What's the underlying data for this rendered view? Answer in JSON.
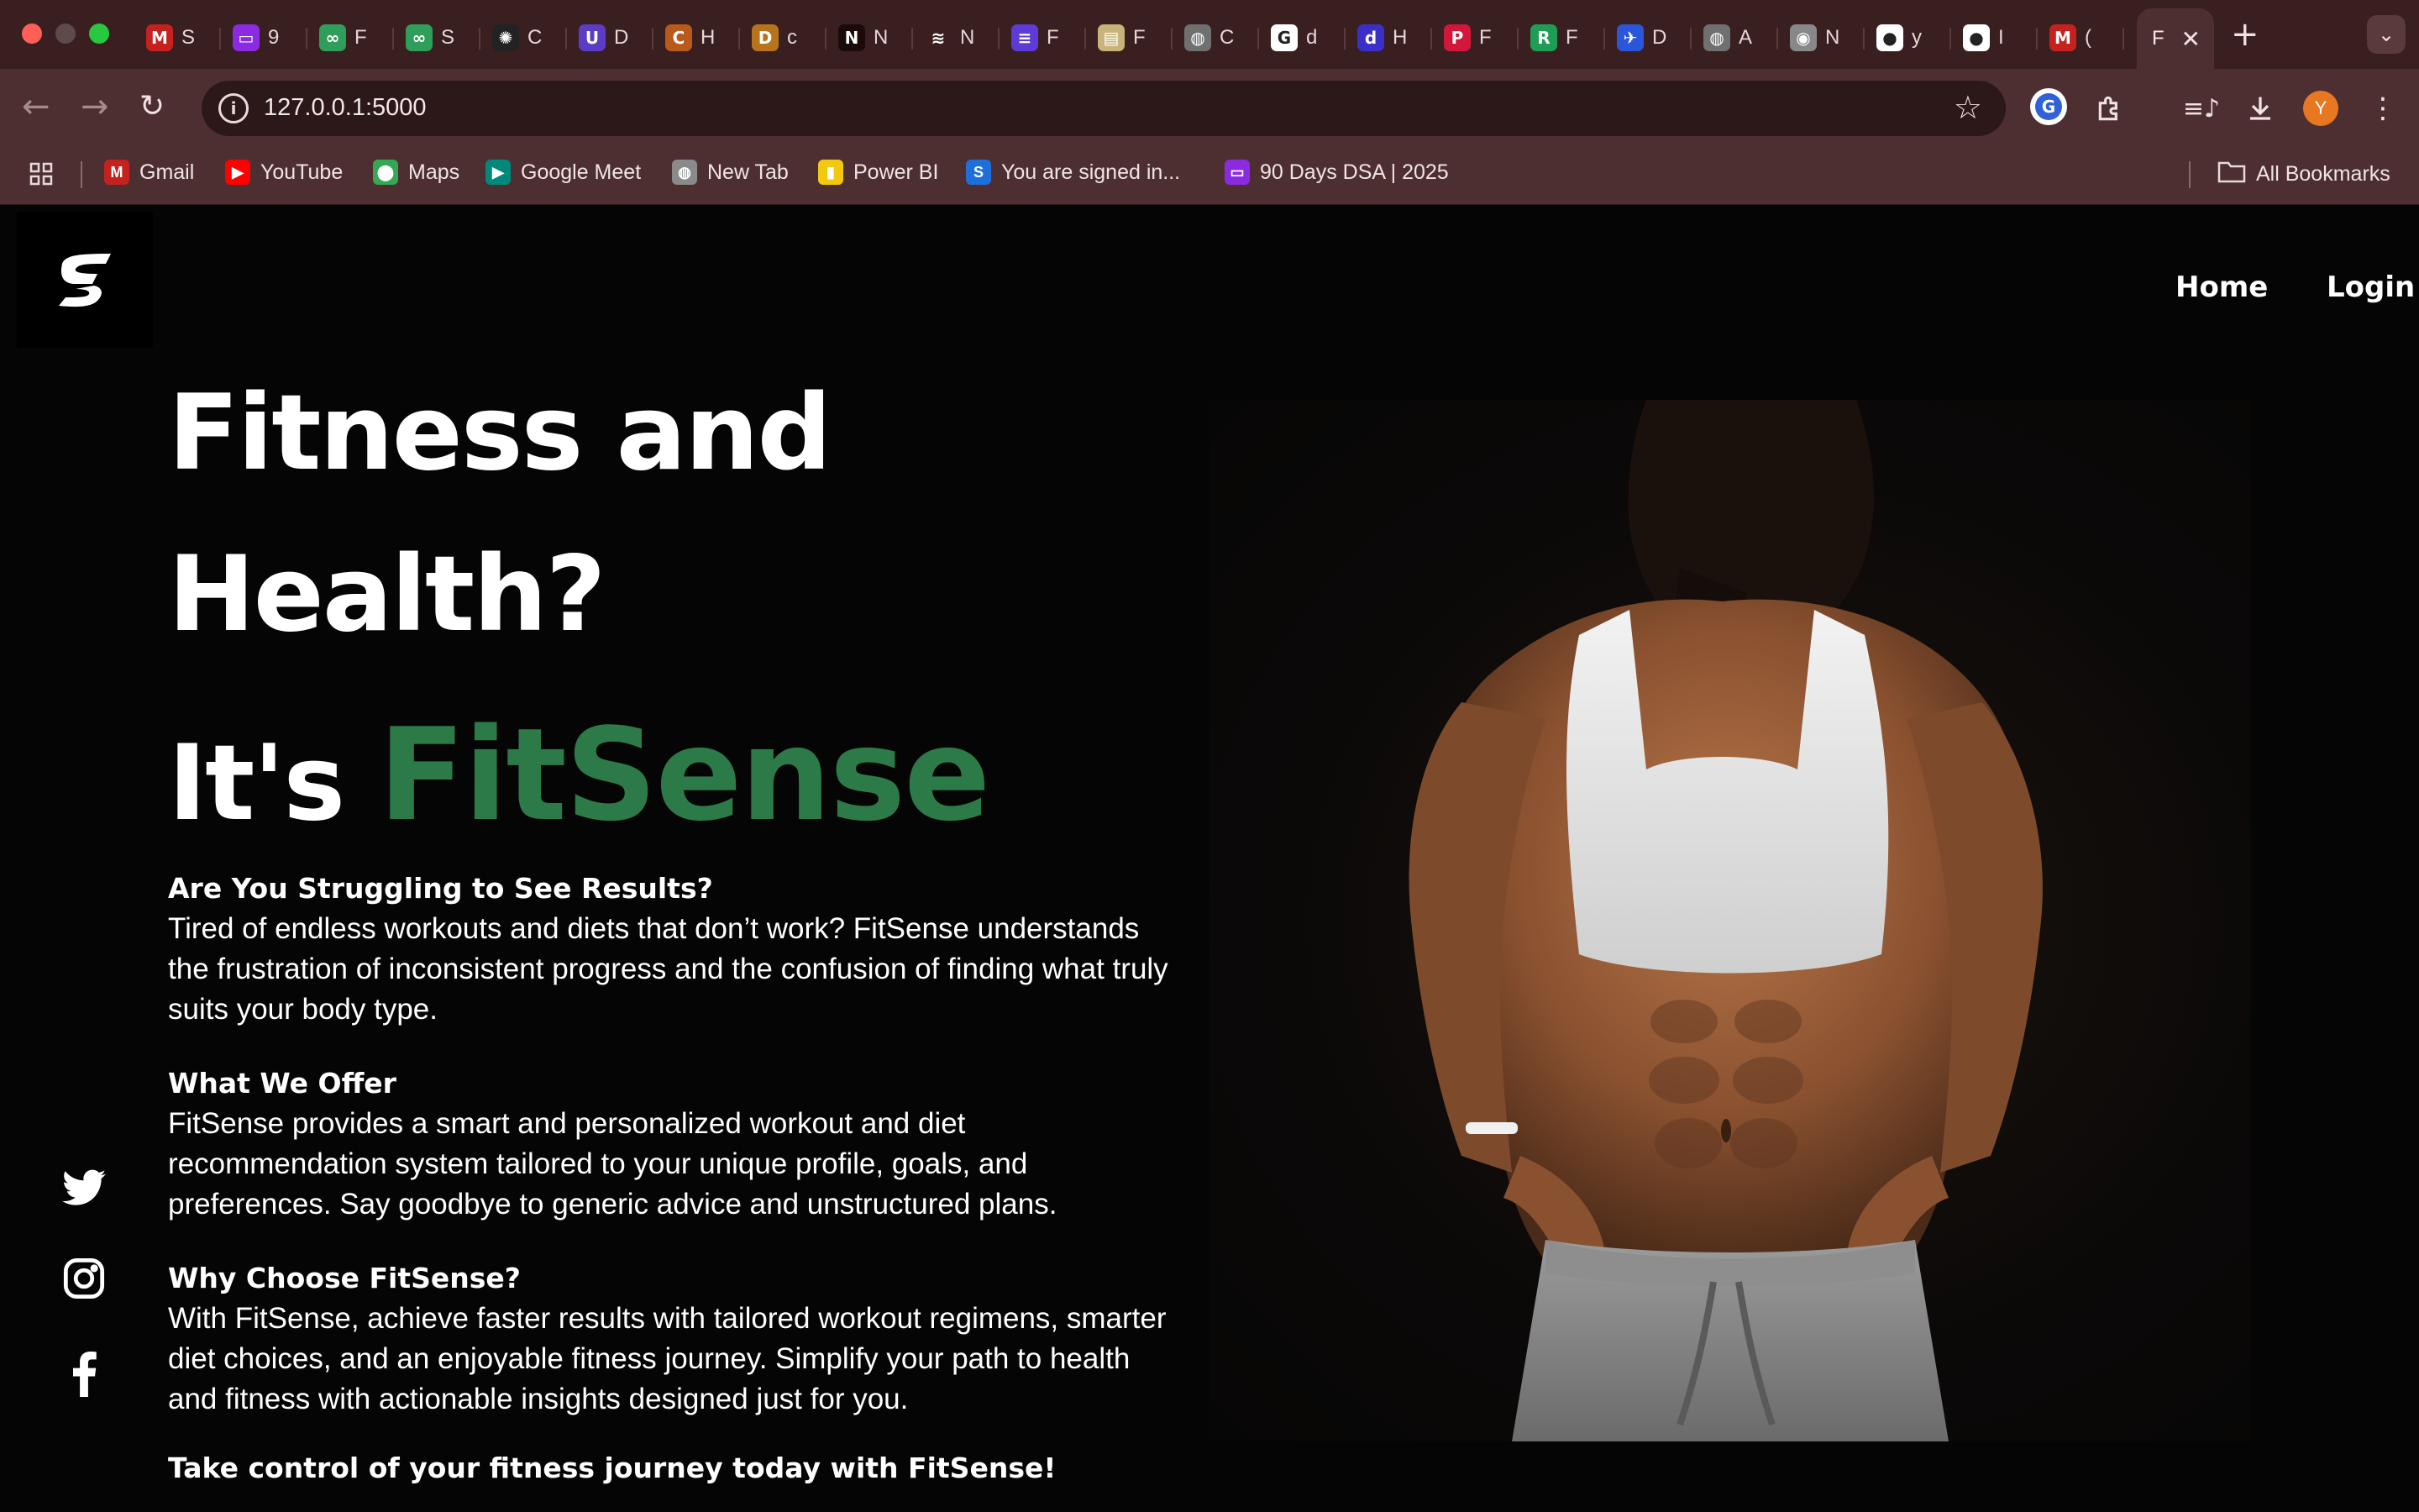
{
  "browser": {
    "tabs": [
      {
        "letter": "S",
        "icon": "gmail-icon",
        "color": "#c5221f",
        "glyph": "M"
      },
      {
        "letter": "9",
        "icon": "screen-icon",
        "color": "#8a2be2",
        "glyph": "▭"
      },
      {
        "letter": "F",
        "icon": "infinity-icon",
        "color": "#2f9e5a",
        "glyph": "∞"
      },
      {
        "letter": "S",
        "icon": "infinity-icon",
        "color": "#2f9e5a",
        "glyph": "∞"
      },
      {
        "letter": "C",
        "icon": "openai-icon",
        "color": "#222222",
        "glyph": "✺"
      },
      {
        "letter": "D",
        "icon": "shield-icon",
        "color": "#5b3cc4",
        "glyph": "U"
      },
      {
        "letter": "H",
        "icon": "circle-icon",
        "color": "#b85a1c",
        "glyph": "C"
      },
      {
        "letter": "c",
        "icon": "doc-icon",
        "color": "#b8741c",
        "glyph": "D"
      },
      {
        "letter": "N",
        "icon": "netflix-icon",
        "color": "#1a0a0a",
        "glyph": "N"
      },
      {
        "letter": "N",
        "icon": "layers-icon",
        "color": "#3a1f21",
        "glyph": "≋"
      },
      {
        "letter": "F",
        "icon": "list-icon",
        "color": "#5c3bd6",
        "glyph": "≡"
      },
      {
        "letter": "F",
        "icon": "card-icon",
        "color": "#c8b37a",
        "glyph": "▤"
      },
      {
        "letter": "C",
        "icon": "globe-icon",
        "color": "#707070",
        "glyph": "◍"
      },
      {
        "letter": "d",
        "icon": "google-icon",
        "color": "#ffffff",
        "glyph": "G"
      },
      {
        "letter": "H",
        "icon": "d-icon",
        "color": "#3b2fc9",
        "glyph": "d"
      },
      {
        "letter": "F",
        "icon": "pinterest-icon",
        "color": "#d3173a",
        "glyph": "P"
      },
      {
        "letter": "F",
        "icon": "r-icon",
        "color": "#1f9d55",
        "glyph": "R"
      },
      {
        "letter": "D",
        "icon": "bird-icon",
        "color": "#2b56d9",
        "glyph": "✈"
      },
      {
        "letter": "A",
        "icon": "globe-icon",
        "color": "#707070",
        "glyph": "◍"
      },
      {
        "letter": "N",
        "icon": "chrome-icon",
        "color": "#888888",
        "glyph": "◉"
      },
      {
        "letter": "y",
        "icon": "github-icon",
        "color": "#ffffff",
        "glyph": "●"
      },
      {
        "letter": "I",
        "icon": "github-icon",
        "color": "#ffffff",
        "glyph": "●"
      },
      {
        "letter": "(",
        "icon": "gmail-icon",
        "color": "#c5221f",
        "glyph": "M"
      }
    ],
    "active_tab_letter": "F",
    "url": "127.0.0.1:5000",
    "profile_initial": "Y",
    "bookmarks": [
      {
        "label": "Gmail",
        "icon": "gmail-icon",
        "color": "#c5221f",
        "glyph": "M"
      },
      {
        "label": "YouTube",
        "icon": "youtube-icon",
        "color": "#ff0000",
        "glyph": "▶"
      },
      {
        "label": "Maps",
        "icon": "maps-icon",
        "color": "#34a853",
        "glyph": "⬤"
      },
      {
        "label": "Google Meet",
        "icon": "meet-icon",
        "color": "#00897b",
        "glyph": "▶"
      },
      {
        "label": "New Tab",
        "icon": "globe-icon",
        "color": "#8a8a8a",
        "glyph": "◍"
      },
      {
        "label": "Power BI",
        "icon": "powerbi-icon",
        "color": "#f2c811",
        "glyph": "▮"
      },
      {
        "label": "You are signed in...",
        "icon": "s-icon",
        "color": "#1e6fd9",
        "glyph": "S"
      },
      {
        "label": "90 Days DSA | 2025",
        "icon": "screen-icon",
        "color": "#8a2be2",
        "glyph": "▭"
      }
    ],
    "all_bookmarks_label": "All Bookmarks"
  },
  "site": {
    "nav": {
      "home": "Home",
      "login": "Login"
    },
    "hero": {
      "line1": "Fitness and",
      "line2": "Health?",
      "line3_prefix": "It's ",
      "line3_brand": "FitSense"
    },
    "sections": [
      {
        "heading": "Are You Struggling to See Results?",
        "body": "Tired of endless workouts and diets that don’t work? FitSense understands the frustration of inconsistent progress and the confusion of finding what truly suits your body type."
      },
      {
        "heading": "What We Offer",
        "body": "FitSense provides a smart and personalized workout and diet recommendation system tailored to your unique profile, goals, and preferences. Say goodbye to generic advice and unstructured plans."
      },
      {
        "heading": "Why Choose FitSense?",
        "body": "With FitSense, achieve faster results with tailored workout regimens, smarter diet choices, and an enjoyable fitness journey. Simplify your path to health and fitness with actionable insights designed just for you."
      }
    ],
    "cta": "Take control of your fitness journey today with FitSense!",
    "brand_color": "#2b7a47"
  }
}
